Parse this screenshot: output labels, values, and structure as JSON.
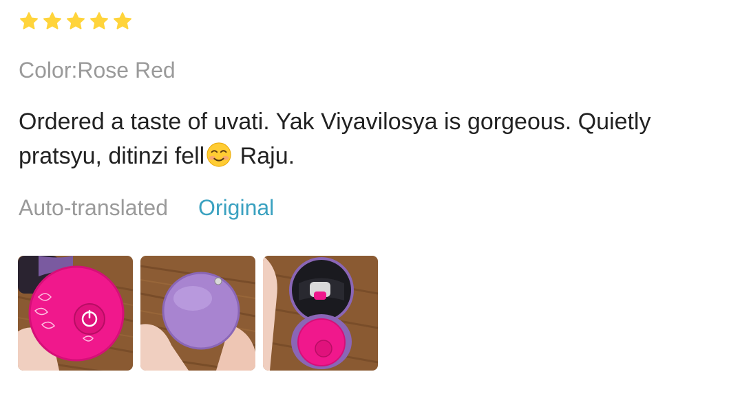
{
  "review": {
    "rating": 5,
    "rating_max": 5,
    "sku_label": "Color:Rose Red",
    "text_part1": "Ordered a taste of uvati. Yak Viyavilosya is gorgeous. Quietly pratsyu, ditinzi fell",
    "text_part2": " Raju.",
    "emoji_icon": "smiling-blush-emoji",
    "auto_translated_label": "Auto-translated",
    "original_link_label": "Original"
  },
  "photos": [
    {
      "icon": "photo-pink-device-hand"
    },
    {
      "icon": "photo-purple-case-hand"
    },
    {
      "icon": "photo-open-case-hand"
    }
  ],
  "colors": {
    "star": "#FFD43B",
    "link": "#3AA1C0",
    "muted": "#9A9A9A",
    "text": "#222222"
  }
}
